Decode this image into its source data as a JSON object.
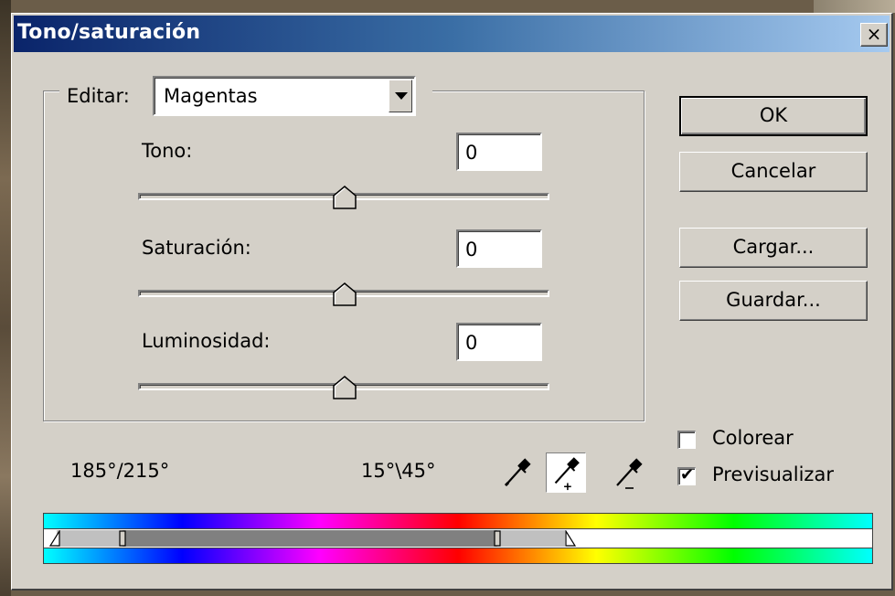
{
  "window": {
    "title": "Tono/saturación",
    "close_label": "×"
  },
  "edit": {
    "label": "Editar:",
    "selected": "Magentas"
  },
  "sliders": [
    {
      "label": "Tono:",
      "value": "0"
    },
    {
      "label": "Saturación:",
      "value": "0"
    },
    {
      "label": "Luminosidad:",
      "value": "0"
    }
  ],
  "buttons": {
    "ok": "OK",
    "cancel": "Cancelar",
    "load": "Cargar...",
    "save": "Guardar..."
  },
  "options": {
    "colorize_label": "Colorear",
    "colorize_checked": false,
    "preview_label": "Previsualizar",
    "preview_checked": true
  },
  "range_readout": {
    "left": "185°/215°",
    "right": "15°\\45°"
  },
  "eyedroppers": [
    {
      "icon": "eyedropper-icon",
      "active": false
    },
    {
      "icon": "eyedropper-add-icon",
      "active": true
    },
    {
      "icon": "eyedropper-subtract-icon",
      "active": false
    }
  ],
  "colors": {
    "dialog_bg": "#d4d0c8",
    "title_start": "#0a246a",
    "title_end": "#a6caf0",
    "range_fill": "#808080",
    "range_falloff": "#c0c0c0"
  }
}
